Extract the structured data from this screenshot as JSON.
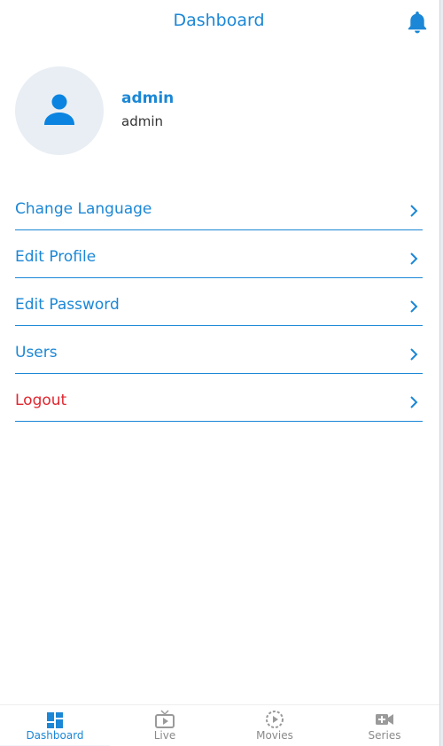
{
  "header": {
    "title": "Dashboard",
    "notification_icon": "bell-icon"
  },
  "profile": {
    "avatar_icon": "person-icon",
    "name": "admin",
    "role": "admin"
  },
  "menu": {
    "items": [
      {
        "label": "Change Language",
        "icon": "chevron-right-icon"
      },
      {
        "label": "Edit Profile",
        "icon": "chevron-right-icon"
      },
      {
        "label": "Edit Password",
        "icon": "chevron-right-icon"
      },
      {
        "label": "Users",
        "icon": "chevron-right-icon"
      },
      {
        "label": "Logout",
        "icon": "chevron-right-icon"
      }
    ]
  },
  "tabbar": {
    "tabs": [
      {
        "label": "Dashboard",
        "icon": "dashboard-grid-icon",
        "active": true
      },
      {
        "label": "Live",
        "icon": "tv-icon",
        "active": false
      },
      {
        "label": "Movies",
        "icon": "play-circle-icon",
        "active": false
      },
      {
        "label": "Series",
        "icon": "video-camera-icon",
        "active": false
      }
    ]
  },
  "colors": {
    "accent": "#1b87d6",
    "danger": "#e0262f",
    "inactive_tab": "#8a8a8a",
    "avatar_bg": "#e8eef4"
  }
}
